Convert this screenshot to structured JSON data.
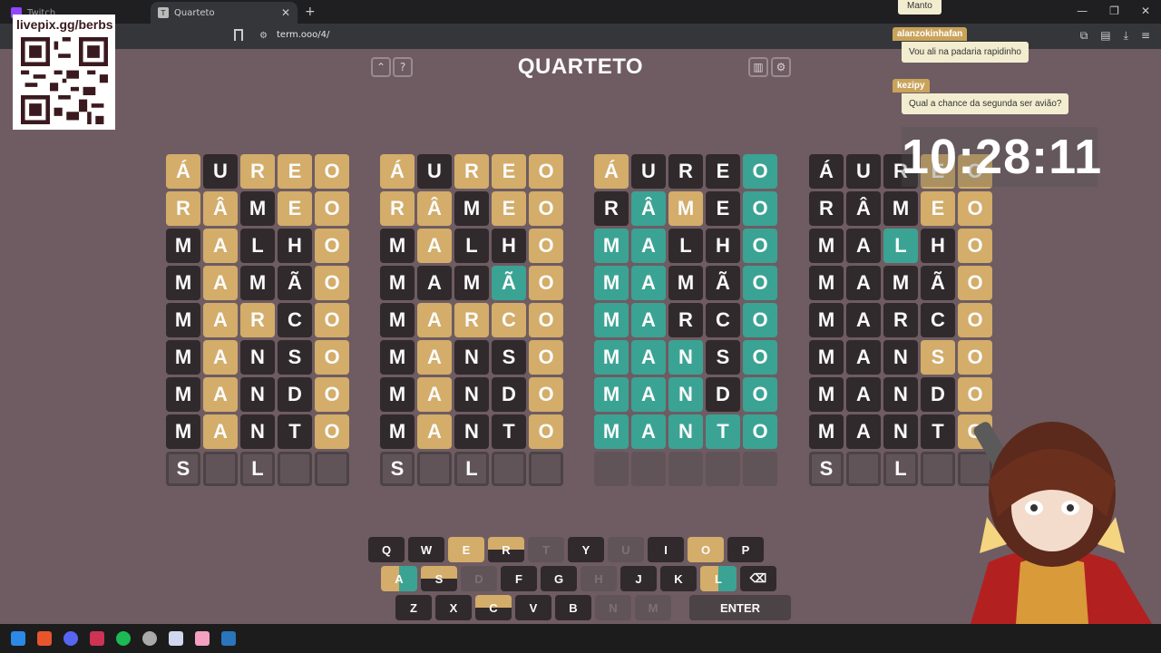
{
  "browser": {
    "tabs": [
      {
        "label": "Twitch",
        "active": false
      },
      {
        "label": "Quarteto",
        "active": true
      }
    ],
    "url": "term.ooo/4/"
  },
  "game": {
    "title": "QUARTETO",
    "boards": [
      {
        "rows": [
          [
            [
              "Á",
              "y"
            ],
            [
              "U",
              "b"
            ],
            [
              "R",
              "y"
            ],
            [
              "E",
              "y"
            ],
            [
              "O",
              "y"
            ]
          ],
          [
            [
              "R",
              "y"
            ],
            [
              "Â",
              "y"
            ],
            [
              "M",
              "b"
            ],
            [
              "E",
              "y"
            ],
            [
              "O",
              "y"
            ]
          ],
          [
            [
              "M",
              "b"
            ],
            [
              "A",
              "y"
            ],
            [
              "L",
              "b"
            ],
            [
              "H",
              "b"
            ],
            [
              "O",
              "y"
            ]
          ],
          [
            [
              "M",
              "b"
            ],
            [
              "A",
              "y"
            ],
            [
              "M",
              "b"
            ],
            [
              "Ã",
              "b"
            ],
            [
              "O",
              "y"
            ]
          ],
          [
            [
              "M",
              "b"
            ],
            [
              "A",
              "y"
            ],
            [
              "R",
              "y"
            ],
            [
              "C",
              "b"
            ],
            [
              "O",
              "y"
            ]
          ],
          [
            [
              "M",
              "b"
            ],
            [
              "A",
              "y"
            ],
            [
              "N",
              "b"
            ],
            [
              "S",
              "b"
            ],
            [
              "O",
              "y"
            ]
          ],
          [
            [
              "M",
              "b"
            ],
            [
              "A",
              "y"
            ],
            [
              "N",
              "b"
            ],
            [
              "D",
              "b"
            ],
            [
              "O",
              "y"
            ]
          ],
          [
            [
              "M",
              "b"
            ],
            [
              "A",
              "y"
            ],
            [
              "N",
              "b"
            ],
            [
              "T",
              "b"
            ],
            [
              "O",
              "y"
            ]
          ],
          [
            [
              "S",
              "t"
            ],
            [
              "",
              "t"
            ],
            [
              "L",
              "t"
            ],
            [
              "",
              "t"
            ],
            [
              "",
              "t"
            ]
          ]
        ]
      },
      {
        "rows": [
          [
            [
              "Á",
              "y"
            ],
            [
              "U",
              "b"
            ],
            [
              "R",
              "y"
            ],
            [
              "E",
              "y"
            ],
            [
              "O",
              "y"
            ]
          ],
          [
            [
              "R",
              "y"
            ],
            [
              "Â",
              "y"
            ],
            [
              "M",
              "b"
            ],
            [
              "E",
              "y"
            ],
            [
              "O",
              "y"
            ]
          ],
          [
            [
              "M",
              "b"
            ],
            [
              "A",
              "y"
            ],
            [
              "L",
              "b"
            ],
            [
              "H",
              "b"
            ],
            [
              "O",
              "y"
            ]
          ],
          [
            [
              "M",
              "b"
            ],
            [
              "A",
              "b"
            ],
            [
              "M",
              "b"
            ],
            [
              "Ã",
              "g"
            ],
            [
              "O",
              "y"
            ]
          ],
          [
            [
              "M",
              "b"
            ],
            [
              "A",
              "y"
            ],
            [
              "R",
              "y"
            ],
            [
              "C",
              "y"
            ],
            [
              "O",
              "y"
            ]
          ],
          [
            [
              "M",
              "b"
            ],
            [
              "A",
              "y"
            ],
            [
              "N",
              "b"
            ],
            [
              "S",
              "b"
            ],
            [
              "O",
              "y"
            ]
          ],
          [
            [
              "M",
              "b"
            ],
            [
              "A",
              "y"
            ],
            [
              "N",
              "b"
            ],
            [
              "D",
              "b"
            ],
            [
              "O",
              "y"
            ]
          ],
          [
            [
              "M",
              "b"
            ],
            [
              "A",
              "y"
            ],
            [
              "N",
              "b"
            ],
            [
              "T",
              "b"
            ],
            [
              "O",
              "y"
            ]
          ],
          [
            [
              "S",
              "t"
            ],
            [
              "",
              "t"
            ],
            [
              "L",
              "t"
            ],
            [
              "",
              "t"
            ],
            [
              "",
              "t"
            ]
          ]
        ]
      },
      {
        "rows": [
          [
            [
              "Á",
              "y"
            ],
            [
              "U",
              "b"
            ],
            [
              "R",
              "b"
            ],
            [
              "E",
              "b"
            ],
            [
              "O",
              "g"
            ]
          ],
          [
            [
              "R",
              "b"
            ],
            [
              "Â",
              "g"
            ],
            [
              "M",
              "y"
            ],
            [
              "E",
              "b"
            ],
            [
              "O",
              "g"
            ]
          ],
          [
            [
              "M",
              "g"
            ],
            [
              "A",
              "g"
            ],
            [
              "L",
              "b"
            ],
            [
              "H",
              "b"
            ],
            [
              "O",
              "g"
            ]
          ],
          [
            [
              "M",
              "g"
            ],
            [
              "A",
              "g"
            ],
            [
              "M",
              "b"
            ],
            [
              "Ã",
              "b"
            ],
            [
              "O",
              "g"
            ]
          ],
          [
            [
              "M",
              "g"
            ],
            [
              "A",
              "g"
            ],
            [
              "R",
              "b"
            ],
            [
              "C",
              "b"
            ],
            [
              "O",
              "g"
            ]
          ],
          [
            [
              "M",
              "g"
            ],
            [
              "A",
              "g"
            ],
            [
              "N",
              "g"
            ],
            [
              "S",
              "b"
            ],
            [
              "O",
              "g"
            ]
          ],
          [
            [
              "M",
              "g"
            ],
            [
              "A",
              "g"
            ],
            [
              "N",
              "g"
            ],
            [
              "D",
              "b"
            ],
            [
              "O",
              "g"
            ]
          ],
          [
            [
              "M",
              "g"
            ],
            [
              "A",
              "g"
            ],
            [
              "N",
              "g"
            ],
            [
              "T",
              "g"
            ],
            [
              "O",
              "g"
            ]
          ],
          [
            [
              "",
              "x"
            ],
            [
              "",
              "x"
            ],
            [
              "",
              "x"
            ],
            [
              "",
              "x"
            ],
            [
              "",
              "x"
            ]
          ]
        ]
      },
      {
        "rows": [
          [
            [
              "Á",
              "b"
            ],
            [
              "U",
              "b"
            ],
            [
              "R",
              "b"
            ],
            [
              "E",
              "y"
            ],
            [
              "O",
              "y"
            ]
          ],
          [
            [
              "R",
              "b"
            ],
            [
              "Â",
              "b"
            ],
            [
              "M",
              "b"
            ],
            [
              "E",
              "y"
            ],
            [
              "O",
              "y"
            ]
          ],
          [
            [
              "M",
              "b"
            ],
            [
              "A",
              "b"
            ],
            [
              "L",
              "g"
            ],
            [
              "H",
              "b"
            ],
            [
              "O",
              "y"
            ]
          ],
          [
            [
              "M",
              "b"
            ],
            [
              "A",
              "b"
            ],
            [
              "M",
              "b"
            ],
            [
              "Ã",
              "b"
            ],
            [
              "O",
              "y"
            ]
          ],
          [
            [
              "M",
              "b"
            ],
            [
              "A",
              "b"
            ],
            [
              "R",
              "b"
            ],
            [
              "C",
              "b"
            ],
            [
              "O",
              "y"
            ]
          ],
          [
            [
              "M",
              "b"
            ],
            [
              "A",
              "b"
            ],
            [
              "N",
              "b"
            ],
            [
              "S",
              "y"
            ],
            [
              "O",
              "y"
            ]
          ],
          [
            [
              "M",
              "b"
            ],
            [
              "A",
              "b"
            ],
            [
              "N",
              "b"
            ],
            [
              "D",
              "b"
            ],
            [
              "O",
              "y"
            ]
          ],
          [
            [
              "M",
              "b"
            ],
            [
              "A",
              "b"
            ],
            [
              "N",
              "b"
            ],
            [
              "T",
              "b"
            ],
            [
              "O",
              "y"
            ]
          ],
          [
            [
              "S",
              "t"
            ],
            [
              "",
              "t"
            ],
            [
              "L",
              "t"
            ],
            [
              "",
              "t"
            ],
            [
              "",
              "t"
            ]
          ]
        ]
      }
    ]
  },
  "keyboard": {
    "row1": [
      {
        "k": "Q",
        "s": "kb"
      },
      {
        "k": "W",
        "s": "kb"
      },
      {
        "k": "E",
        "s": "ky"
      },
      {
        "k": "R",
        "s": "half2"
      },
      {
        "k": "T",
        "s": "used"
      },
      {
        "k": "Y",
        "s": "kb"
      },
      {
        "k": "U",
        "s": "used"
      },
      {
        "k": "I",
        "s": "kb"
      },
      {
        "k": "O",
        "s": "ky"
      },
      {
        "k": "P",
        "s": "kb"
      }
    ],
    "row2": [
      {
        "k": "A",
        "s": "quad"
      },
      {
        "k": "S",
        "s": "half2"
      },
      {
        "k": "D",
        "s": "used"
      },
      {
        "k": "F",
        "s": "kb"
      },
      {
        "k": "G",
        "s": "kb"
      },
      {
        "k": "H",
        "s": "used"
      },
      {
        "k": "J",
        "s": "kb"
      },
      {
        "k": "K",
        "s": "kb"
      },
      {
        "k": "L",
        "s": "quad"
      },
      {
        "k": "⌫",
        "s": "kb"
      }
    ],
    "row3": [
      {
        "k": "Z",
        "s": "kb"
      },
      {
        "k": "X",
        "s": "kb"
      },
      {
        "k": "C",
        "s": "half2"
      },
      {
        "k": "V",
        "s": "kb"
      },
      {
        "k": "B",
        "s": "kb"
      },
      {
        "k": "N",
        "s": "used"
      },
      {
        "k": "M",
        "s": "used"
      }
    ],
    "enter_label": "ENTER"
  },
  "overlay": {
    "qr_label": "livepix.gg/berbs",
    "chat": [
      {
        "user": "",
        "msg": "Manto",
        "color": "#f3edd0"
      },
      {
        "user": "alanzokinhafan",
        "msg": "Vou ali na padaria rapidinho",
        "color": "#c9a35a"
      },
      {
        "user": "kezipy",
        "msg": "Qual a chance da segunda ser avião?",
        "color": "#c9a35a"
      }
    ],
    "clock": "10:28:11"
  },
  "colors": {
    "yellow": "#d3ad69",
    "black": "#312a2c",
    "green": "#3aa394",
    "background": "#6e5c62"
  }
}
